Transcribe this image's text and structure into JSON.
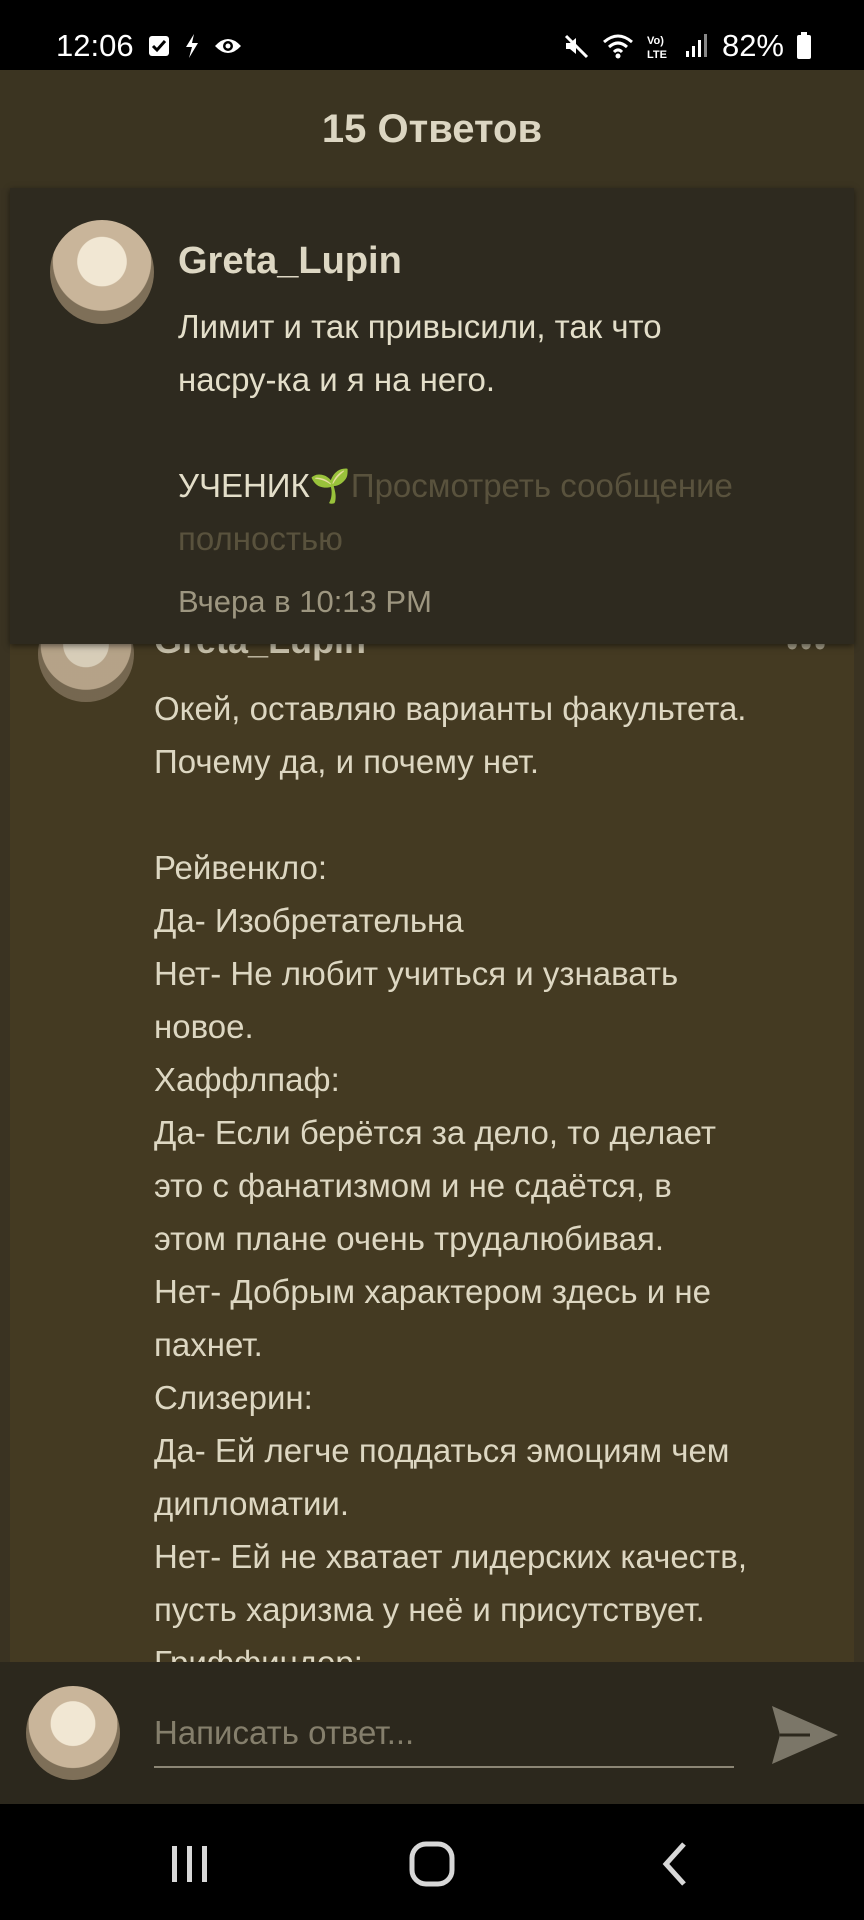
{
  "status_bar": {
    "time": "12:06",
    "battery": "82%",
    "left_icons": [
      "checkbox-icon",
      "bolt-icon",
      "eye-icon"
    ],
    "right_icons": [
      "mute-icon",
      "wifi-icon",
      "volte-icon",
      "signal-icon",
      "battery-icon"
    ]
  },
  "header": {
    "title": "15 Ответов"
  },
  "original_post": {
    "author": "Greta_Lupin",
    "text_lines": [
      "Лимит и так привысили, так что",
      "насру-ка и я на него.",
      "",
      "УЧЕНИК🌱"
    ],
    "more_link": "Просмотреть сообщение полностью",
    "time": "Вчера в 10:13 PM"
  },
  "reply": {
    "author": "Greta_Lupin",
    "more": "•••",
    "lines": [
      "Окей, оставляю варианты факультета.",
      "Почему да, и почему нет.",
      "",
      "Рейвенкло:",
      "Да- Изобретательна",
      "Нет- Не любит учиться и узнавать",
      "новое.",
      "Хаффлпаф:",
      "Да- Если берётся за дело, то делает",
      "это с фанатизмом и не сдаётся, в",
      "этом плане очень трудалюбивая.",
      "Нет- Добрым характером здесь и не",
      "пахнет.",
      "Слизерин:",
      "Да- Ей легче поддаться эмоциям чем",
      "дипломатии.",
      "Нет- Ей не хватает лидерских качеств,",
      "пусть харизма у неё и присутствует.",
      "Гриффиндор:"
    ]
  },
  "composer": {
    "placeholder": "Написать ответ...",
    "send_icon": "send-icon"
  },
  "nav": {
    "icons": [
      "recent-apps-icon",
      "home-icon",
      "back-icon"
    ]
  },
  "colors": {
    "background": "#3a3322",
    "header_bg": "#2e2a1f",
    "reply_bg": "#443a22",
    "composer_bg": "#2c281d"
  }
}
